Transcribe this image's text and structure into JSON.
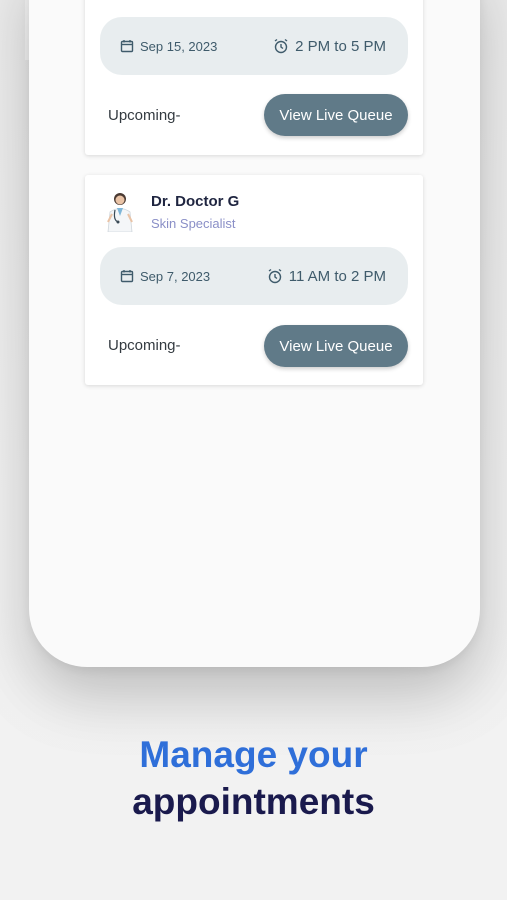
{
  "appointments": [
    {
      "date": "Sep 15, 2023",
      "time": "2 PM to 5 PM",
      "status": "Upcoming-",
      "button_label": "View Live Queue"
    },
    {
      "doctor_name": "Dr. Doctor G",
      "specialty": "Skin Specialist",
      "date": "Sep 7, 2023",
      "time": "11 AM to 2 PM",
      "status": "Upcoming-",
      "button_label": "View Live Queue"
    }
  ],
  "headline": {
    "line1": "Manage your",
    "line2": "appointments"
  },
  "colors": {
    "accent_blue": "#2f6fd9",
    "dark_navy": "#1a1a4d",
    "button_slate": "#607a88",
    "info_box_bg": "#e8edef"
  },
  "icons": {
    "date": "calendar-icon",
    "time": "alarm-clock-icon",
    "avatar": "doctor-avatar-icon"
  }
}
